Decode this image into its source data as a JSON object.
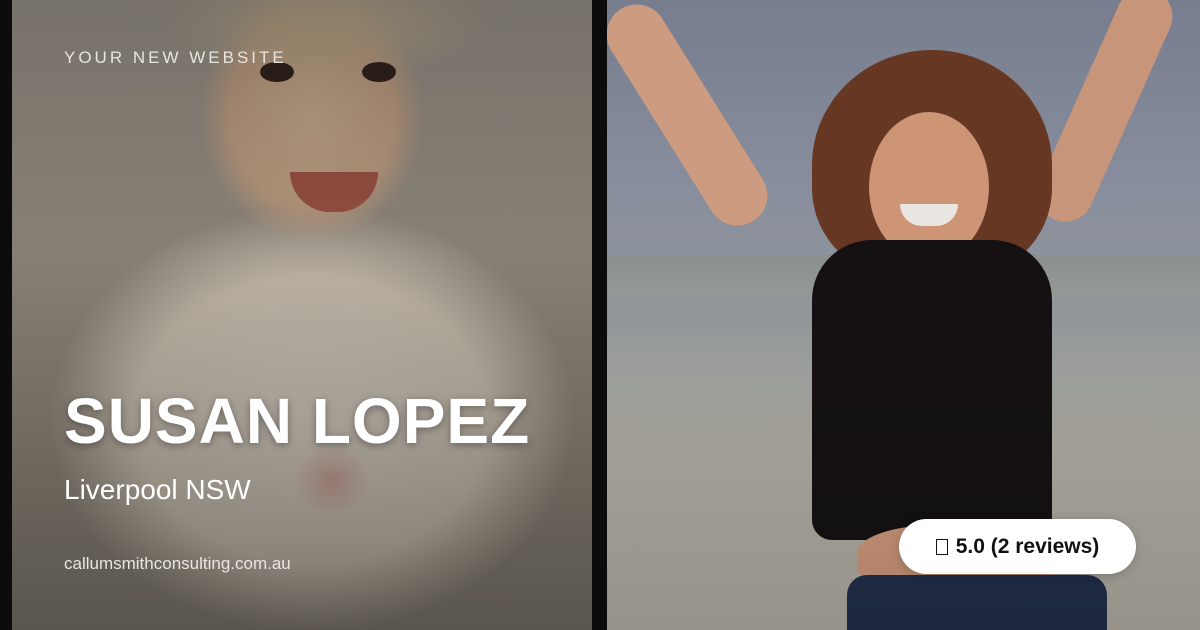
{
  "header": {
    "eyebrow": "YOUR NEW WEBSITE"
  },
  "profile": {
    "name": "SUSAN LOPEZ",
    "location": "Liverpool NSW",
    "website": "callumsmithconsulting.com.au"
  },
  "rating": {
    "icon": "star-icon",
    "text": "5.0 (2 reviews)"
  },
  "colors": {
    "background": "#0c0c0c",
    "text": "#ffffff",
    "badge_bg": "#ffffff",
    "badge_text": "#111111"
  }
}
